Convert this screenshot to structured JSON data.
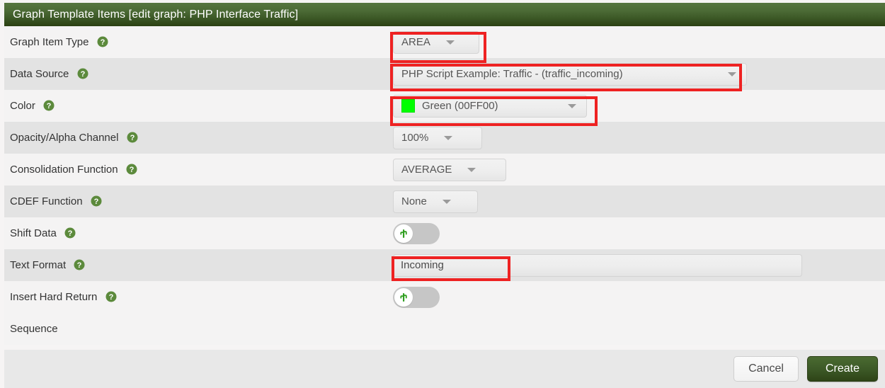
{
  "header": {
    "title": "Graph Template Items [edit graph: PHP Interface Traffic]"
  },
  "rows": [
    {
      "label": "Graph Item Type",
      "value": "AREA"
    },
    {
      "label": "Data Source",
      "value": "PHP Script Example: Traffic - (traffic_incoming)"
    },
    {
      "label": "Color",
      "value": "Green (00FF00)"
    },
    {
      "label": "Opacity/Alpha Channel",
      "value": "100%"
    },
    {
      "label": "Consolidation Function",
      "value": "AVERAGE"
    },
    {
      "label": "CDEF Function",
      "value": "None"
    },
    {
      "label": "Shift Data",
      "value": ""
    },
    {
      "label": "Text Format",
      "value": "Incoming"
    },
    {
      "label": "Insert Hard Return",
      "value": ""
    },
    {
      "label": "Sequence",
      "value": ""
    }
  ],
  "text_format": {
    "value": "Incoming",
    "placeholder": ""
  },
  "colors": {
    "swatch_hex": "#00FF00",
    "header_green": "#3a5524",
    "accent_green": "#4a6b31",
    "highlight_red": "#EE2222"
  },
  "icons": {
    "help": "help-icon",
    "caret": "chevron-down-icon",
    "toggle": "cacti-logo-icon"
  },
  "footer": {
    "cancel_label": "Cancel",
    "create_label": "Create"
  }
}
